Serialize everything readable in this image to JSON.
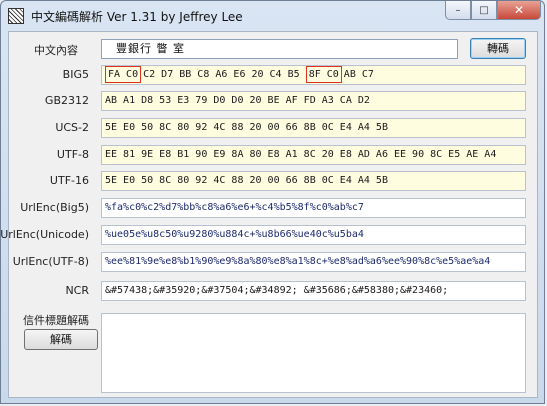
{
  "window": {
    "title": "中文編碼解析 Ver 1.31 by Jeffrey Lee",
    "min_glyph": "–",
    "max_glyph": "□",
    "close_glyph": "✕"
  },
  "input": {
    "label": "中文內容",
    "value": "豐銀行 瞥  室",
    "button": "轉碼"
  },
  "rows": [
    {
      "label": "BIG5",
      "hl1": "FA C0",
      "mid": "C2 D7 BB C8 A6 E6 20 C4 B5",
      "hl2": "8F C0",
      "tail": "AB C7"
    },
    {
      "label": "GB2312",
      "value": "AB A1 D8 53 E3 79 D0 D0 20 BE AF FD A3 CA D2"
    },
    {
      "label": "UCS-2",
      "value": "5E E0 50 8C 80 92 4C 88 20 00 66 8B 0C E4 A4 5B"
    },
    {
      "label": "UTF-8",
      "value": "EE 81 9E E8 B1 90 E9 8A 80 E8 A1 8C 20 E8 AD A6 EE 90 8C E5 AE A4"
    },
    {
      "label": "UTF-16",
      "value": "5E E0 50 8C 80 92 4C 88 20 00 66 8B 0C E4 A4 5B"
    },
    {
      "label": "UrlEnc(Big5)",
      "value": "%fa%c0%c2%d7%bb%c8%a6%e6+%c4%b5%8f%c0%ab%c7"
    },
    {
      "label": "UrlEnc(Unicode)",
      "value": "%ue05e%u8c50%u9280%u884c+%u8b66%ue40c%u5ba4"
    },
    {
      "label": "UrlEnc(UTF-8)",
      "value": "%ee%81%9e%e8%b1%90%e9%8a%80%e8%a1%8c+%e8%ad%a6%ee%90%8c%e5%ae%a4"
    },
    {
      "label": "NCR",
      "value": "&#57438;&#35920;&#37504;&#34892; &#35686;&#58380;&#23460;"
    }
  ],
  "decode": {
    "label": "信件標題解碼",
    "button": "解碼",
    "value": ""
  }
}
